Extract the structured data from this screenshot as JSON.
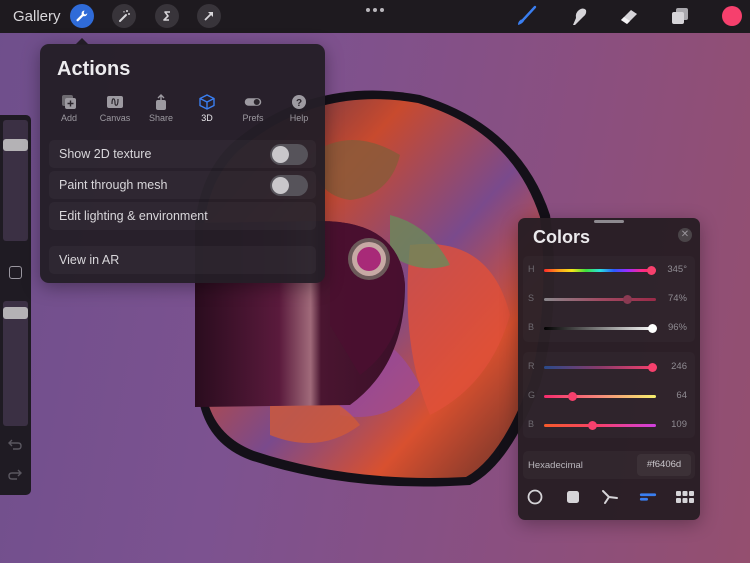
{
  "topbar": {
    "gallery_label": "Gallery",
    "left_tools": [
      {
        "name": "actions",
        "icon": "wrench-icon",
        "active": true
      },
      {
        "name": "adjustments",
        "icon": "magic-wand-icon",
        "active": false
      },
      {
        "name": "selection",
        "icon": "selection-s-icon",
        "active": false
      },
      {
        "name": "transform",
        "icon": "arrow-cursor-icon",
        "active": false
      }
    ],
    "more_icon": "more-dots-icon",
    "right_tools": [
      {
        "name": "brush",
        "icon": "brush-icon",
        "active": true
      },
      {
        "name": "smudge",
        "icon": "smudge-finger-icon",
        "active": false
      },
      {
        "name": "eraser",
        "icon": "eraser-icon",
        "active": false
      },
      {
        "name": "layers",
        "icon": "layers-icon",
        "active": false
      }
    ],
    "current_color": "#f6406d"
  },
  "sidebar": {
    "brush_size": 0.83,
    "opacity": 0.95,
    "modify_button": "square-icon",
    "undo_icon": "undo-icon",
    "redo_icon": "redo-icon"
  },
  "actions_panel": {
    "title": "Actions",
    "tabs": [
      {
        "label": "Add",
        "icon": "add-icon",
        "active": false
      },
      {
        "label": "Canvas",
        "icon": "canvas-icon",
        "active": false
      },
      {
        "label": "Share",
        "icon": "share-icon",
        "active": false
      },
      {
        "label": "3D",
        "icon": "cube-icon",
        "active": true
      },
      {
        "label": "Prefs",
        "icon": "toggle-icon",
        "active": false
      },
      {
        "label": "Help",
        "icon": "help-icon",
        "active": false
      }
    ],
    "rows": [
      {
        "label": "Show 2D texture",
        "toggle": false
      },
      {
        "label": "Paint through mesh",
        "toggle": false
      },
      {
        "label": "Edit lighting & environment"
      },
      {
        "label": "View in AR"
      }
    ]
  },
  "colors_panel": {
    "title": "Colors",
    "hsb": [
      {
        "label": "H",
        "value": "345°",
        "fraction": 0.958
      },
      {
        "label": "S",
        "value": "74%",
        "fraction": 0.74
      },
      {
        "label": "B",
        "value": "96%",
        "fraction": 0.96
      }
    ],
    "rgb": [
      {
        "label": "R",
        "value": "246",
        "fraction": 0.965
      },
      {
        "label": "G",
        "value": "64",
        "fraction": 0.251
      },
      {
        "label": "B",
        "value": "109",
        "fraction": 0.427
      }
    ],
    "hex_label": "Hexadecimal",
    "hex_value": "#f6406d",
    "modes": [
      {
        "name": "disc",
        "icon": "circle-icon",
        "active": false
      },
      {
        "name": "classic",
        "icon": "square-icon",
        "active": false
      },
      {
        "name": "harmony",
        "icon": "harmony-icon",
        "active": false
      },
      {
        "name": "value",
        "icon": "sliders-icon",
        "active": true
      },
      {
        "name": "palettes",
        "icon": "grid-icon",
        "active": false
      }
    ]
  }
}
